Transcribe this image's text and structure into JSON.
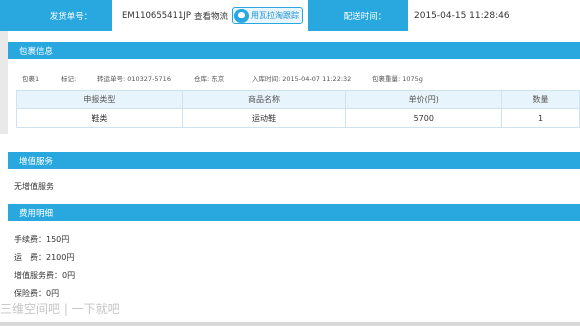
{
  "top": {
    "ship_label": "发货单号：",
    "ship_value": "EM110655411JP",
    "view_logistics": "查看物流",
    "track_button": "用瓦拉淘跟踪",
    "time_label": "配送时间：",
    "time_value": "2015-04-15 11:28:46"
  },
  "package": {
    "title": "包裹信息",
    "meta": {
      "pkg": "包裹1",
      "mark": "标记:",
      "transfer": "转运单号: 010327-5716",
      "warehouse": "仓库: 东京",
      "in_time": "入库时间: 2015-04-07 11:22:32",
      "weight": "包裹重量: 1075g"
    },
    "columns": [
      "申报类型",
      "商品名称",
      "单价(円)",
      "数量"
    ],
    "rows": [
      [
        "鞋类",
        "运动鞋",
        "5700",
        "1"
      ]
    ]
  },
  "value_added": {
    "title": "增值服务",
    "text": "无增值服务"
  },
  "fees": {
    "title": "费用明细",
    "items": [
      "手续费：150円",
      "运　费：2100円",
      "增值服务费：0円",
      "保险费：0円"
    ]
  },
  "watermark": "三维空间吧 | 一下就吧"
}
